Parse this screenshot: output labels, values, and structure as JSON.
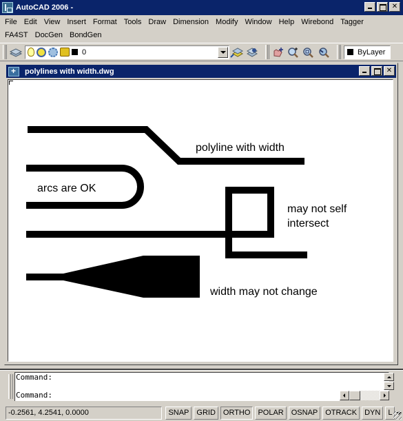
{
  "app": {
    "title": "AutoCAD 2006",
    "title_suffix": " -"
  },
  "menu": {
    "row1": [
      "File",
      "Edit",
      "View",
      "Insert",
      "Format",
      "Tools",
      "Draw",
      "Dimension",
      "Modify",
      "Window",
      "Help",
      "Wirebond",
      "Tagger"
    ],
    "row2": [
      "FA4ST",
      "DocGen",
      "BondGen"
    ]
  },
  "toolbar": {
    "layer_value": "0",
    "color_value": "ByLayer",
    "icons": [
      "layer-manager-icon",
      "layer-on-icon",
      "layer-thaw-icon",
      "layer-freeze-viewport-icon",
      "layer-lock-icon",
      "make-object-layer-current-icon",
      "layer-previous-icon",
      "pan-realtime-icon",
      "zoom-realtime-icon",
      "zoom-window-icon",
      "zoom-previous-icon"
    ]
  },
  "document": {
    "title": "polylines with width.dwg"
  },
  "drawing": {
    "labels": {
      "polyline_with_width": "polyline with width",
      "arcs_ok": "arcs are OK",
      "self_intersect_line1": "may not self",
      "self_intersect_line2": "intersect",
      "width_change": "width may not change"
    },
    "colors": {
      "stroke": "#000000",
      "background": "#ffffff"
    }
  },
  "command": {
    "history_line": "Command:",
    "prompt": "Command:"
  },
  "status": {
    "coordinates": "-0.2561, 4.2541, 0.0000",
    "buttons": [
      {
        "label": "SNAP",
        "on": false
      },
      {
        "label": "GRID",
        "on": false
      },
      {
        "label": "ORTHO",
        "on": true
      },
      {
        "label": "POLAR",
        "on": false
      },
      {
        "label": "OSNAP",
        "on": false
      },
      {
        "label": "OTRACK",
        "on": false
      },
      {
        "label": "DYN",
        "on": false
      },
      {
        "label": "L",
        "on": false
      }
    ]
  }
}
